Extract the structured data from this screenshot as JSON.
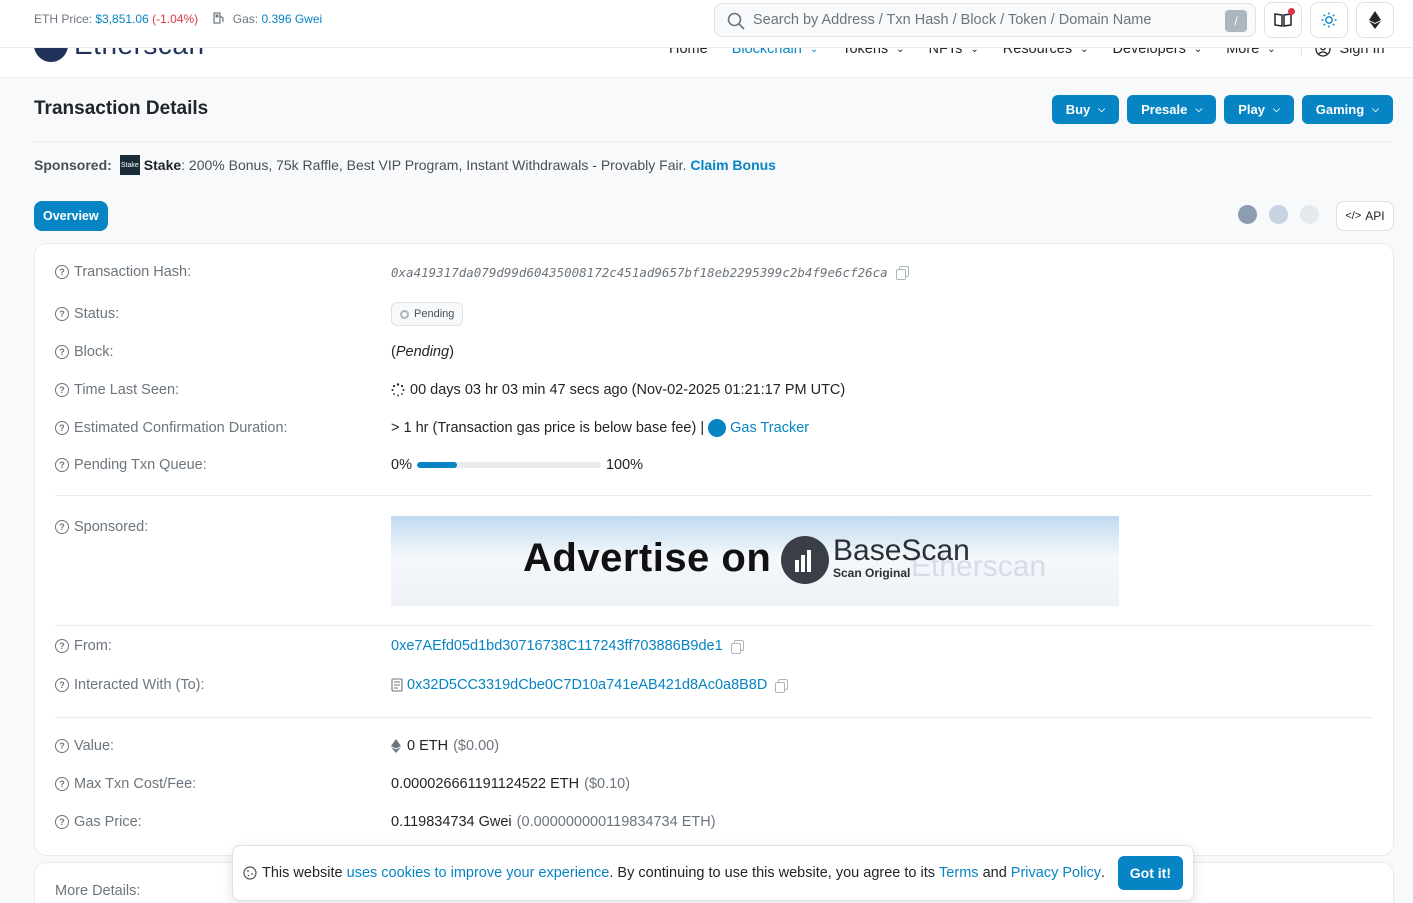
{
  "topbar": {
    "eth_price_label": "ETH Price:",
    "eth_price_value": "$3,851.06",
    "eth_price_change": "(-1.04%)",
    "gas_label": "Gas:",
    "gas_value": "0.396 Gwei",
    "search_placeholder": "Search by Address / Txn Hash / Block / Token / Domain Name",
    "search_shortcut": "/"
  },
  "nav": {
    "logo_text": "Etherscan",
    "items": [
      {
        "label": "Home"
      },
      {
        "label": "Blockchain"
      },
      {
        "label": "Tokens"
      },
      {
        "label": "NFTs"
      },
      {
        "label": "Resources"
      },
      {
        "label": "Developers"
      },
      {
        "label": "More"
      }
    ],
    "signin": "Sign In"
  },
  "page": {
    "title": "Transaction Details",
    "buttons": [
      "Buy",
      "Presale",
      "Play",
      "Gaming"
    ]
  },
  "sponsored_bar": {
    "label": "Sponsored:",
    "logo_text": "Stake",
    "name": "Stake",
    "text": ": 200% Bonus, 75k Raffle, Best VIP Program, Instant Withdrawals - Provably Fair.",
    "cta": "Claim Bonus"
  },
  "tabs": {
    "overview": "Overview",
    "api": "API"
  },
  "details": {
    "tx_hash_label": "Transaction Hash:",
    "tx_hash": "0xa419317da079d99d60435008172c451ad9657bf18eb2295399c2b4f9e6cf26ca",
    "status_label": "Status:",
    "status": "Pending",
    "block_label": "Block:",
    "block_open": "(",
    "block": "Pending",
    "block_close": ")",
    "time_label": "Time Last Seen:",
    "time": "00 days 03 hr 03 min 47 secs ago (Nov-02-2025 01:21:17 PM UTC)",
    "eta_label": "Estimated Confirmation Duration:",
    "eta": "> 1 hr (Transaction gas price is below base fee) |",
    "gas_tracker": "Gas Tracker",
    "queue_label": "Pending Txn Queue:",
    "queue_min": "0%",
    "queue_max": "100%",
    "queue_fill": 0.22,
    "sponsored_label": "Sponsored:",
    "ad_text": "Advertise on",
    "ad_brand": "BaseScan",
    "ad_tagline": "Scan Original",
    "ad_ghost": "Etherscan",
    "from_label": "From:",
    "from": "0xe7AEfd05d1bd30716738C117243ff703886B9de1",
    "to_label": "Interacted With (To):",
    "to": "0x32D5CC3319dCbe0C7D10a741eAB421d8Ac0a8B8D",
    "value_label": "Value:",
    "value": "0 ETH",
    "value_usd": "($0.00)",
    "fee_label": "Max Txn Cost/Fee:",
    "fee": "0.000026661191124522 ETH",
    "fee_usd": "($0.10)",
    "gas_price_label": "Gas Price:",
    "gas_price": "0.119834734 Gwei",
    "gas_price_eth": "(0.000000000119834734 ETH)"
  },
  "more_details": {
    "label": "More Details:"
  },
  "cookie": {
    "text1": "This website",
    "link1": "uses cookies to improve your experience",
    "text2": ". By continuing to use this website, you agree to its",
    "terms": "Terms",
    "and": "and",
    "privacy": "Privacy Policy",
    "dot": ".",
    "button": "Got it!"
  },
  "colors": {
    "accent": "#0784c3",
    "negative": "#dc3545",
    "dot1": "#8c9db0",
    "dot2": "#c6d3e3",
    "dot3": "#e4e9ef"
  }
}
